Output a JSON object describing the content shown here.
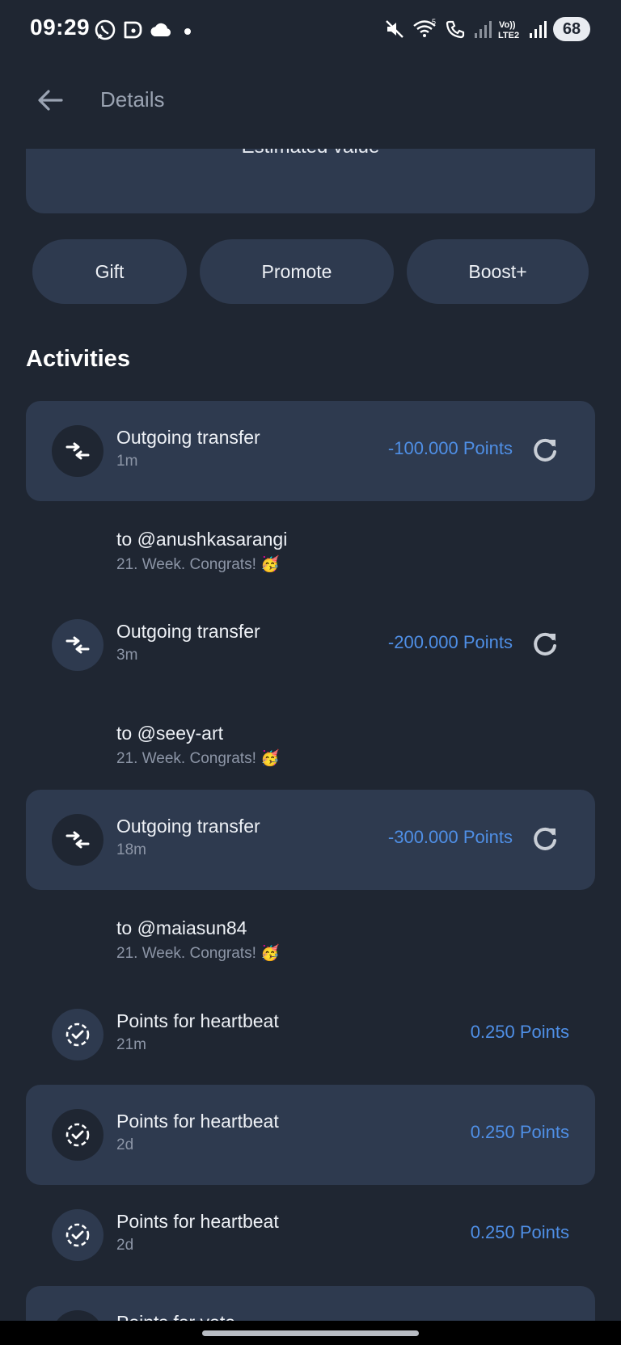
{
  "status_bar": {
    "time": "09:29",
    "battery": "68",
    "left_icons": [
      "whatsapp-icon",
      "chat-icon",
      "cloud-icon",
      "dot-icon"
    ],
    "right_icons": [
      "mute-icon",
      "wifi-icon",
      "wifi-call-icon",
      "signal-icon",
      "volte-icon",
      "signal-icon"
    ],
    "volte_label": "Vo))\nLTE2"
  },
  "app_bar": {
    "title": "Details"
  },
  "value_card": {
    "label": "Estimated value"
  },
  "actions": {
    "gift": "Gift",
    "promote": "Promote",
    "boost": "Boost+"
  },
  "activities_title": "Activities",
  "activities": [
    {
      "title": "Outgoing transfer",
      "time": "1m",
      "amount": "-100.000 Points",
      "icon": "transfer-icon",
      "retry": true,
      "to": "to @anushkasarangi",
      "message": "21. Week. Congrats! 🥳"
    },
    {
      "title": "Outgoing transfer",
      "time": "3m",
      "amount": "-200.000 Points",
      "icon": "transfer-icon",
      "retry": true,
      "to": "to @seey-art",
      "message": "21. Week. Congrats! 🥳"
    },
    {
      "title": "Outgoing transfer",
      "time": "18m",
      "amount": "-300.000 Points",
      "icon": "transfer-icon",
      "retry": true,
      "to": "to @maiasun84",
      "message": "21. Week. Congrats! 🥳"
    },
    {
      "title": "Points for heartbeat",
      "time": "21m",
      "amount": "0.250 Points",
      "icon": "heartbeat-check-icon",
      "retry": false
    },
    {
      "title": "Points for heartbeat",
      "time": "2d",
      "amount": "0.250 Points",
      "icon": "heartbeat-check-icon",
      "retry": false
    },
    {
      "title": "Points for heartbeat",
      "time": "2d",
      "amount": "0.250 Points",
      "icon": "heartbeat-check-icon",
      "retry": false
    },
    {
      "title": "Points for vote",
      "time": "",
      "amount": "",
      "icon": "vote-icon",
      "retry": false
    }
  ],
  "colors": {
    "background": "#1f2632",
    "card": "#2e3a4f",
    "accent": "#4f8fe6",
    "muted_text": "#8c95a6"
  }
}
